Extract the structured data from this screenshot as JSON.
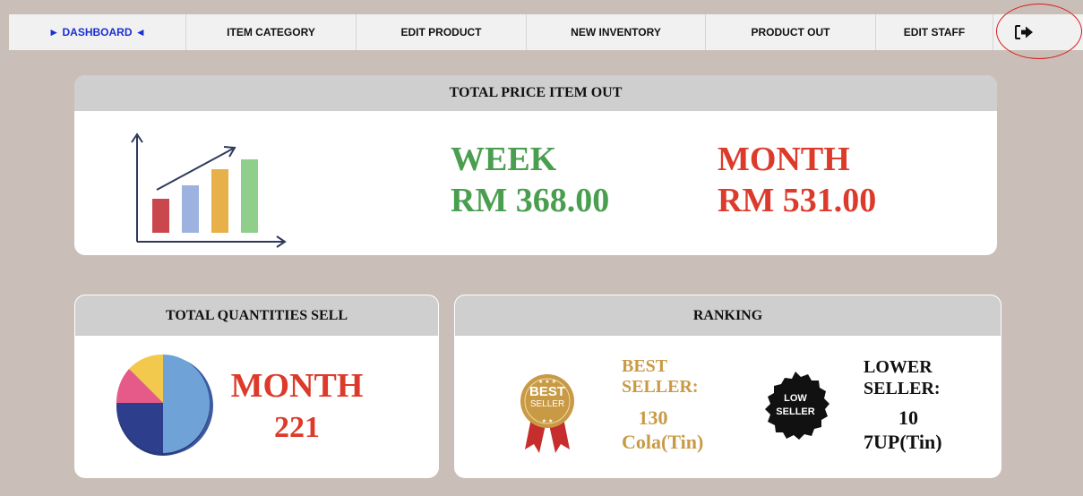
{
  "nav": {
    "items": [
      "► DASHBOARD ◄",
      "ITEM CATEGORY",
      "EDIT PRODUCT",
      "NEW INVENTORY",
      "PRODUCT OUT",
      "EDIT STAFF"
    ],
    "active_color": "#1a2fd4",
    "logout_icon": "sign-out-icon"
  },
  "total_price": {
    "title": "TOTAL PRICE ITEM OUT",
    "week_label": "WEEK",
    "week_value": "RM 368.00",
    "month_label": "MONTH",
    "month_value": "RM 531.00",
    "week_color": "#4a9e4f",
    "month_color": "#dc3a2b",
    "icon": "bar-chart-icon"
  },
  "quantities": {
    "title": "TOTAL QUANTITIES SELL",
    "label": "MONTH",
    "value": "221",
    "icon": "pie-chart-icon"
  },
  "ranking": {
    "title": "RANKING",
    "best_badge_line1": "BEST",
    "best_badge_line2": "SELLER",
    "best_label": "BEST SELLER:",
    "best_qty": "130",
    "best_item": "Cola(Tin)",
    "low_badge_line1": "LOW",
    "low_badge_line2": "SELLER",
    "low_label": "LOWER SELLER:",
    "low_qty": "10",
    "low_item": "7UP(Tin)",
    "gold_color": "#c99a45"
  }
}
